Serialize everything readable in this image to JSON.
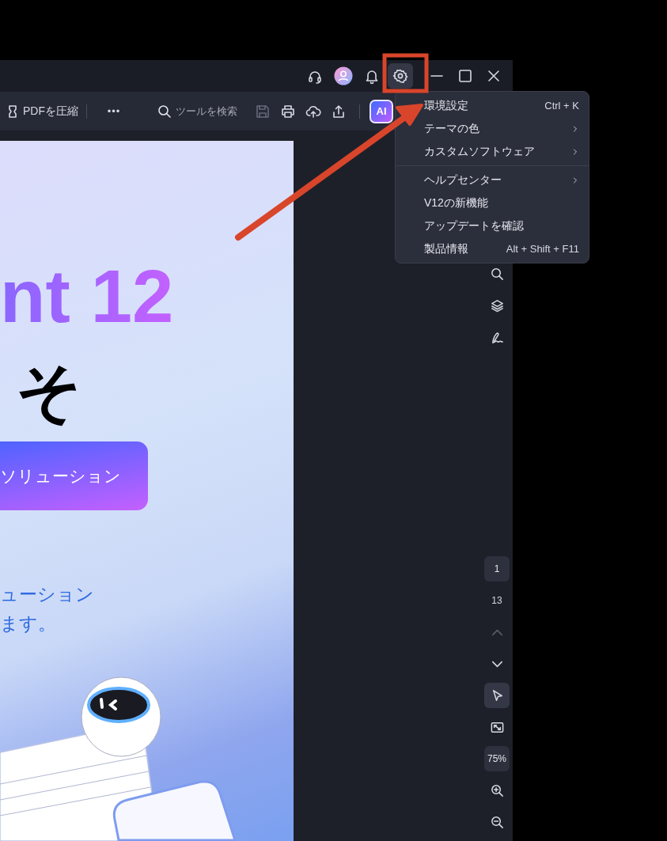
{
  "title_bar": {
    "settings_active": true
  },
  "toolbar": {
    "compress_label": "PDFを圧縮",
    "more": "•••",
    "search": {
      "placeholder": "ツールを検索"
    },
    "save_disabled": true,
    "ai_badge": "AI"
  },
  "document": {
    "title_fragment": "nt 12",
    "heading_fragment": "そ",
    "banner_text": "ソリューション",
    "body_lines": [
      "ューション",
      "ます。"
    ]
  },
  "menu": {
    "sections": [
      [
        {
          "label": "環境設定",
          "shortcut": "Ctrl + K",
          "submenu": false
        },
        {
          "label": "テーマの色",
          "submenu": true
        },
        {
          "label": "カスタムソフトウェア",
          "submenu": true
        }
      ],
      [
        {
          "label": "ヘルプセンター",
          "submenu": true
        },
        {
          "label": "V12の新機能",
          "submenu": false
        },
        {
          "label": "アップデートを確認",
          "submenu": false
        },
        {
          "label": "製品情報",
          "shortcut": "Alt + Shift + F11",
          "submenu": false
        }
      ]
    ]
  },
  "sidebar": {
    "page": "1",
    "total": "13",
    "prev_disabled": true,
    "select_tool_selected": true,
    "zoom": "75%"
  }
}
